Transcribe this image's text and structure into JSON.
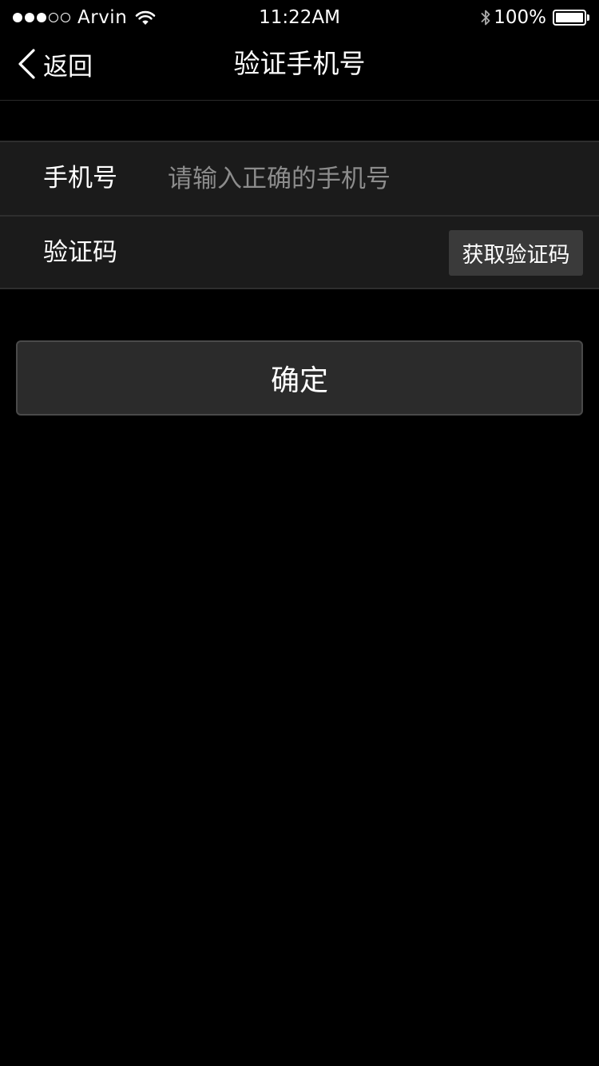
{
  "status_bar": {
    "signal_full": 3,
    "signal_total": 5,
    "carrier": "Arvin",
    "time": "11:22AM",
    "battery": "100%",
    "icons": [
      "signal-dots",
      "wifi-icon",
      "bluetooth-icon",
      "battery-icon"
    ]
  },
  "nav": {
    "back_label": "返回",
    "title": "验证手机号",
    "back_icon": "chevron-left-icon"
  },
  "form": {
    "phone": {
      "label": "手机号",
      "placeholder": "请输入正确的手机号",
      "value": ""
    },
    "code": {
      "label": "验证码",
      "value": "",
      "button_label": "获取验证码"
    }
  },
  "confirm_label": "确定",
  "colors": {
    "background": "#000000",
    "form_background": "#1b1b1b",
    "divider": "#2e2e2e",
    "button": "#3a3a3a",
    "placeholder": "#8c8c8c",
    "text": "#ffffff"
  }
}
